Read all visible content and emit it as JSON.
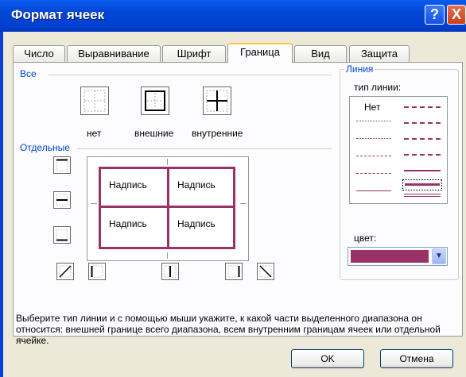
{
  "window": {
    "title": "Формат ячеек",
    "help_glyph": "?",
    "close_glyph": "X"
  },
  "tabs": [
    "Число",
    "Выравнивание",
    "Шрифт",
    "Граница",
    "Вид",
    "Защита"
  ],
  "active_tab": "Граница",
  "presets": {
    "group_label": "Все",
    "items": [
      "нет",
      "внешние",
      "внутренние"
    ]
  },
  "border": {
    "group_label": "Отдельные",
    "preview_text": [
      "Надпись",
      "Надпись",
      "Надпись",
      "Надпись"
    ]
  },
  "line": {
    "group_label": "Линия",
    "style_label": "тип линии:",
    "none_label": "Нет",
    "color_label": "цвет:",
    "color": "#993366"
  },
  "hint": "Выберите тип линии и с помощью мыши укажите, к какой части выделенного диапазона он относится: внешней границе всего диапазона, всем внутренним границам ячеек или отдельной ячейке.",
  "buttons": {
    "ok": "OK",
    "cancel": "Отмена"
  }
}
